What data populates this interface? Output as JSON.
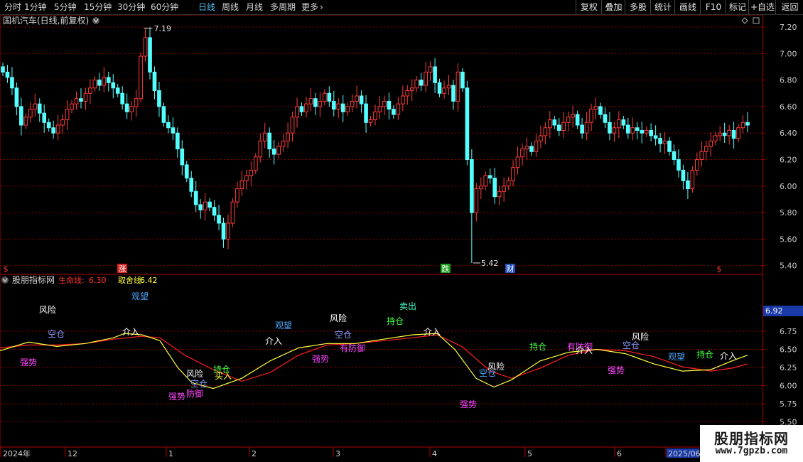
{
  "toolbar": {
    "periods": [
      "分时",
      "1分钟",
      "5分钟",
      "15分钟",
      "30分钟",
      "60分钟",
      "日线",
      "周线",
      "月线",
      "多周期",
      "更多"
    ],
    "active_period": "日线",
    "more_chevron": "chevron-right-icon",
    "right_buttons": [
      "复权",
      "叠加",
      "多股",
      "统计",
      "画线",
      "F10",
      "标记",
      "+自选",
      "返回"
    ]
  },
  "main_chart": {
    "title": "国机汽车(日线,前复权)",
    "title_arrow_icon": "chevron-down-icon",
    "diamond_icon": "diamond-icon",
    "square_icon": "square-icon",
    "high_label": "7.19",
    "low_label": "5.42",
    "y_ticks": [
      "7.20",
      "7.00",
      "6.80",
      "6.60",
      "6.40",
      "6.20",
      "6.00",
      "5.80",
      "5.60",
      "5.40"
    ],
    "event_markers": [
      {
        "text": "$",
        "color": "#ff4040",
        "bg": "none"
      },
      {
        "text": "涨",
        "color": "#ffffff",
        "bg": "#d02020"
      },
      {
        "text": "跌",
        "color": "#ffffff",
        "bg": "#20a020"
      },
      {
        "text": "财",
        "color": "#ffffff",
        "bg": "#2050c0"
      },
      {
        "text": "$",
        "color": "#ff4040",
        "bg": "none"
      }
    ]
  },
  "indicator": {
    "name": "股朋指标网",
    "arrow_icon": "chevron-down-icon",
    "life_line_label": "生命线",
    "life_line_value": "6.30",
    "decision_line_label": "取舍线",
    "decision_line_value": "6.42",
    "current_value_badge": "6.92",
    "y_ticks": [
      "6.75",
      "6.50",
      "6.25",
      "6.00",
      "5.75",
      "5.50"
    ],
    "annotations": [
      {
        "text": "风险",
        "color": "#ffffff"
      },
      {
        "text": "观望",
        "color": "#4da6ff"
      },
      {
        "text": "空仓",
        "color": "#8899ff"
      },
      {
        "text": "介入",
        "color": "#ffffff"
      },
      {
        "text": "强势",
        "color": "#ff44ff"
      },
      {
        "text": "风险",
        "color": "#ffffff"
      },
      {
        "text": "空仓",
        "color": "#8899ff"
      },
      {
        "text": "持仓",
        "color": "#44ff44"
      },
      {
        "text": "买入",
        "color": "#ffff44"
      },
      {
        "text": "强势",
        "color": "#ff44ff"
      },
      {
        "text": "防御",
        "color": "#ff44ff"
      },
      {
        "text": "介入",
        "color": "#ffffff"
      },
      {
        "text": "观望",
        "color": "#4da6ff"
      },
      {
        "text": "风险",
        "color": "#ffffff"
      },
      {
        "text": "空仓",
        "color": "#8899ff"
      },
      {
        "text": "强势",
        "color": "#ff44ff"
      },
      {
        "text": "有防御",
        "color": "#ff44ff"
      },
      {
        "text": "持仓",
        "color": "#44ff44"
      },
      {
        "text": "卖出",
        "color": "#44ffcc"
      },
      {
        "text": "介入",
        "color": "#ffffff"
      },
      {
        "text": "风险",
        "color": "#ffffff"
      },
      {
        "text": "空仓",
        "color": "#4da6ff"
      },
      {
        "text": "强势",
        "color": "#ff44ff"
      },
      {
        "text": "持仓",
        "color": "#44ff44"
      },
      {
        "text": "有防御",
        "color": "#ff44ff"
      },
      {
        "text": "介入",
        "color": "#ffffff"
      },
      {
        "text": "空仓",
        "color": "#8899ff"
      },
      {
        "text": "风险",
        "color": "#ffffff"
      },
      {
        "text": "强势",
        "color": "#ff44ff"
      },
      {
        "text": "观望",
        "color": "#4da6ff"
      },
      {
        "text": "持仓",
        "color": "#44ff44"
      },
      {
        "text": "介入",
        "color": "#ffffff"
      }
    ]
  },
  "time_axis": [
    "2024年",
    "12",
    "1",
    "2",
    "3",
    "4",
    "5",
    "6",
    "2025/06"
  ],
  "watermark": {
    "name": "股朋指标网",
    "url": "www.7gpzb.com"
  },
  "colors": {
    "up": "#ff3c3c",
    "down": "#54ffff",
    "life_line": "#ff2020",
    "decision_line": "#ffff40",
    "grid": "#8b0000",
    "axis_border": "#b00000"
  }
}
